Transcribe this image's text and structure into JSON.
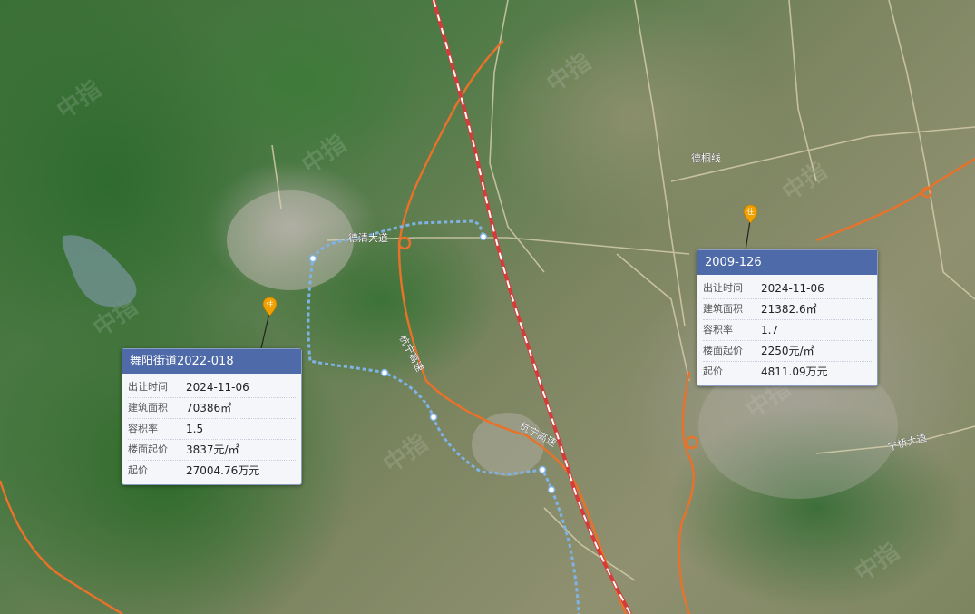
{
  "road_labels": {
    "deqing_avenue": "德清大道",
    "deheng_line": "德桐线",
    "hangning_expressway_1": "杭宁高速",
    "hangning_expressway_2": "杭宁高速",
    "ningqiao_avenue": "宁桥大道"
  },
  "pins": [
    {
      "id": "pin-left",
      "glyph": "住",
      "color": "#f0a000"
    },
    {
      "id": "pin-right",
      "glyph": "住",
      "color": "#f0a000"
    }
  ],
  "parcels": [
    {
      "title": "舞阳街道2022-018",
      "rows": [
        {
          "k": "出让时间",
          "v": "2024-11-06"
        },
        {
          "k": "建筑面积",
          "v": "70386㎡"
        },
        {
          "k": "容积率",
          "v": "1.5"
        },
        {
          "k": "楼面起价",
          "v": "3837元/㎡"
        },
        {
          "k": "起价",
          "v": "27004.76万元"
        }
      ]
    },
    {
      "title": "2009-126",
      "rows": [
        {
          "k": "出让时间",
          "v": "2024-11-06"
        },
        {
          "k": "建筑面积",
          "v": "21382.6㎡"
        },
        {
          "k": "容积率",
          "v": "1.7"
        },
        {
          "k": "楼面起价",
          "v": "2250元/㎡"
        },
        {
          "k": "起价",
          "v": "4811.09万元"
        }
      ]
    }
  ],
  "colors": {
    "highway": "#e8722a",
    "railway": "#d83a3a",
    "metro": "#7fb3e6",
    "popup_header": "#4f6aa8"
  }
}
